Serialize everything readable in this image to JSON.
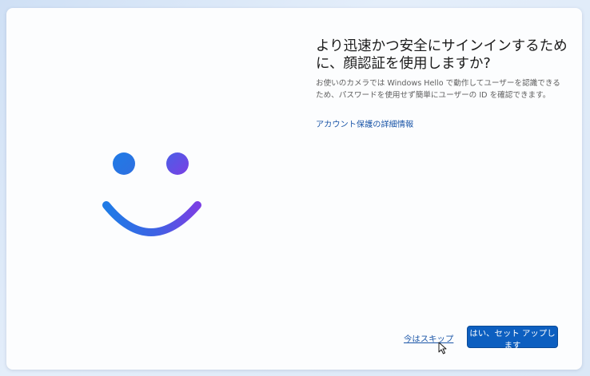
{
  "dialog": {
    "title": "より迅速かつ安全にサインインするために、顔認証を使用しますか?",
    "description": "お使いのカメラでは Windows Hello で動作してユーザーを認識できるため、パスワードを使用せず簡単にユーザーの ID を確認できます。",
    "link_label": "アカウント保護の詳細情報",
    "illustration_icon": "smiley-face-icon"
  },
  "buttons": {
    "skip_label": "今はスキップ",
    "setup_label": "はい、セット アップします"
  },
  "colors": {
    "accent": "#0d5fc0",
    "link": "#1b56a8",
    "face_gradient_start": "#1a73e8",
    "face_gradient_end": "#7b3fe4"
  }
}
